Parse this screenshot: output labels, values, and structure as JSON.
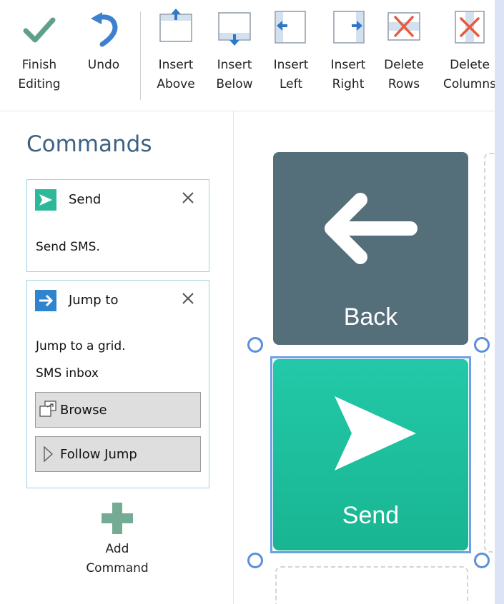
{
  "ribbon": {
    "buttons": [
      {
        "id": "finish-editing",
        "line1": "Finish",
        "line2": "Editing",
        "icon": "checkmark-icon"
      },
      {
        "id": "undo",
        "line1": "Undo",
        "line2": "",
        "icon": "undo-icon"
      },
      {
        "id": "insert-above",
        "line1": "Insert",
        "line2": "Above",
        "icon": "insert-row-above-icon"
      },
      {
        "id": "insert-below",
        "line1": "Insert",
        "line2": "Below",
        "icon": "insert-row-below-icon"
      },
      {
        "id": "insert-left",
        "line1": "Insert",
        "line2": "Left",
        "icon": "insert-column-left-icon"
      },
      {
        "id": "insert-right",
        "line1": "Insert",
        "line2": "Right",
        "icon": "insert-column-right-icon"
      },
      {
        "id": "delete-rows",
        "line1": "Delete",
        "line2": "Rows",
        "icon": "delete-row-icon"
      },
      {
        "id": "delete-columns",
        "line1": "Delete",
        "line2": "Columns",
        "icon": "delete-column-icon"
      }
    ]
  },
  "commands": {
    "title": "Commands",
    "cards": [
      {
        "title": "Send",
        "description": "Send SMS.",
        "icon": "send-icon",
        "color": "#2cb99a"
      },
      {
        "title": "Jump to",
        "description": "Jump to a grid.",
        "target": "SMS inbox",
        "icon": "arrow-right-icon",
        "color": "#2f84cf",
        "browse_label": "Browse",
        "follow_label": "Follow Jump"
      }
    ],
    "add_label_line1": "Add",
    "add_label_line2": "Command"
  },
  "grid": {
    "tiles": [
      {
        "label": "Back",
        "icon": "back-arrow-icon",
        "color": "#546e7a"
      },
      {
        "label": "Send",
        "icon": "send-icon",
        "color": "#1ec7a2"
      }
    ]
  },
  "colors": {
    "accent": "#3b6283",
    "selection": "#6aa2e6",
    "checkmark": "#5fa08a"
  }
}
